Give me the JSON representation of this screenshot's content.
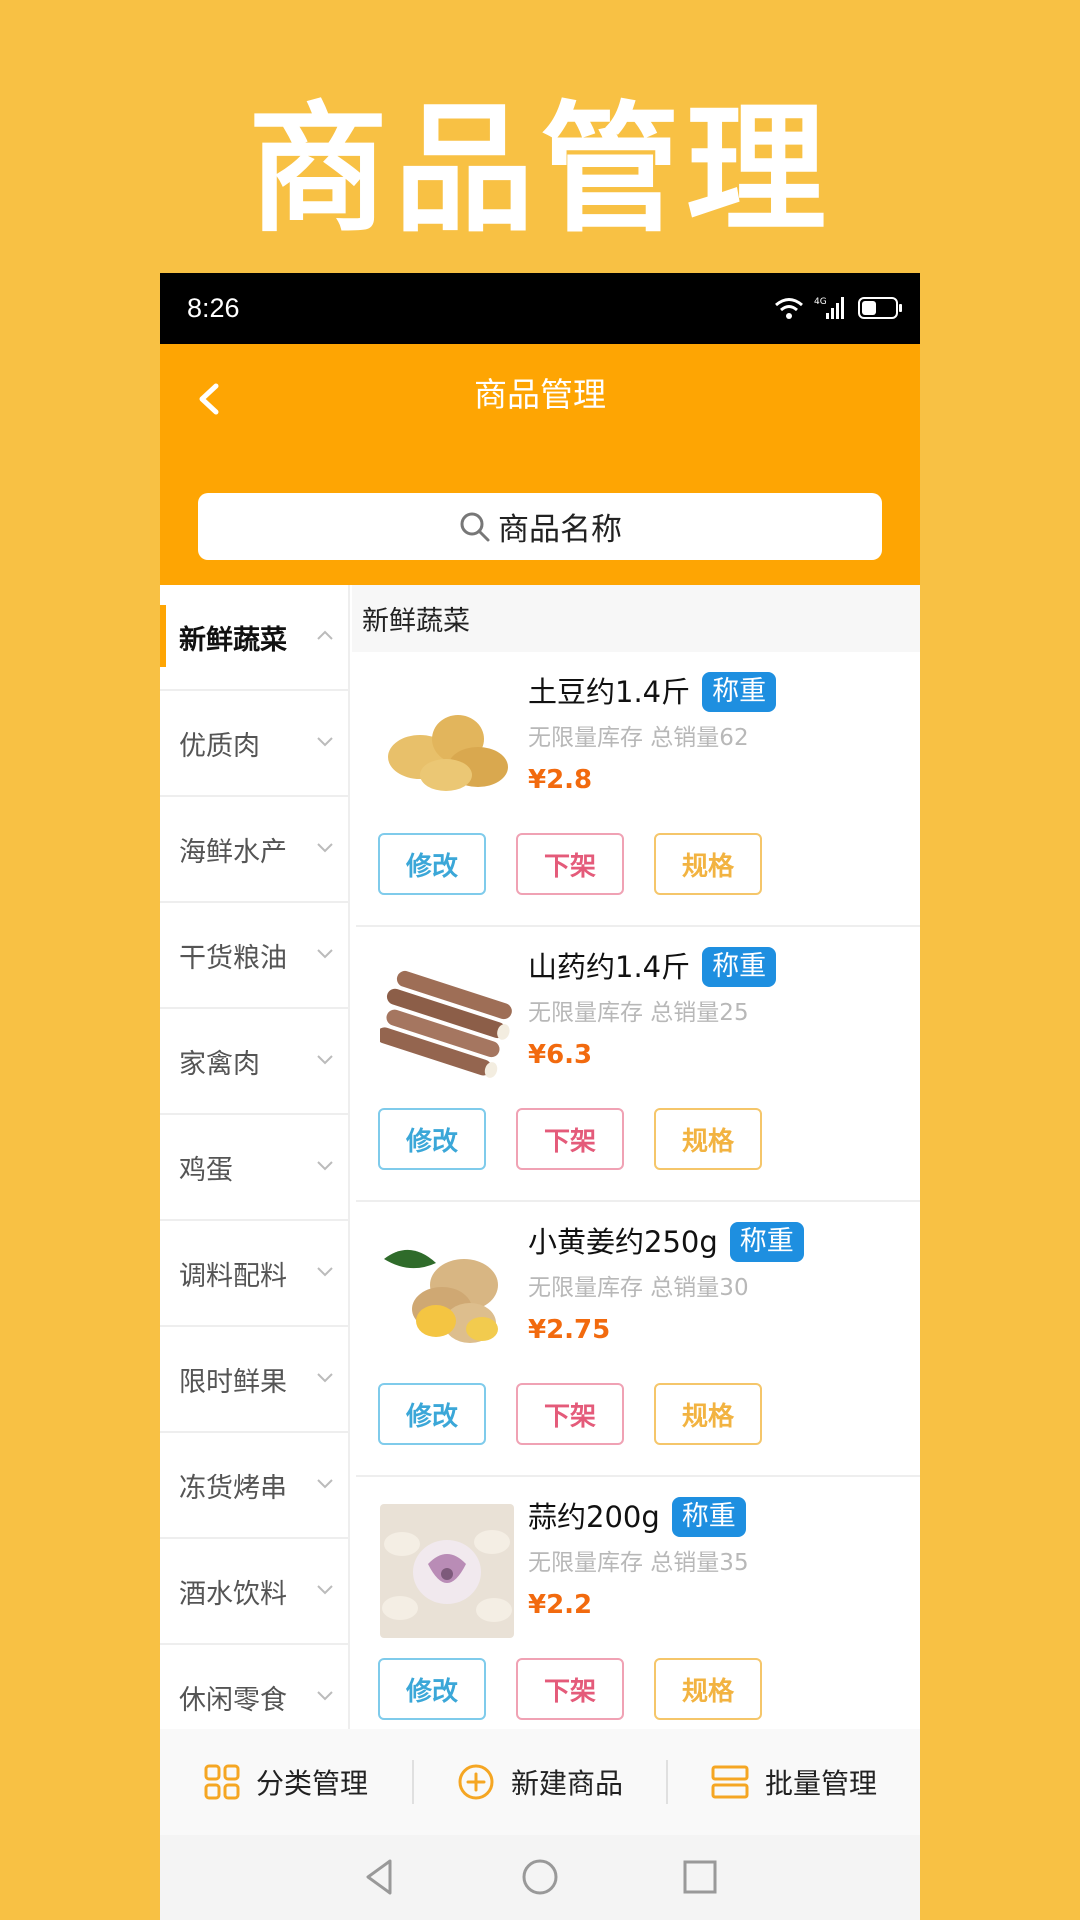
{
  "banner_title": "商品管理",
  "status": {
    "time": "8:26",
    "network": "4G"
  },
  "header": {
    "title": "商品管理"
  },
  "search": {
    "placeholder": "商品名称"
  },
  "categories": [
    {
      "label": "新鲜蔬菜",
      "active": true
    },
    {
      "label": "优质肉"
    },
    {
      "label": "海鲜水产"
    },
    {
      "label": "干货粮油"
    },
    {
      "label": "家禽肉"
    },
    {
      "label": "鸡蛋"
    },
    {
      "label": "调料配料"
    },
    {
      "label": "限时鲜果"
    },
    {
      "label": "冻货烤串"
    },
    {
      "label": "酒水饮料"
    },
    {
      "label": "休闲零食"
    }
  ],
  "section_title": "新鲜蔬菜",
  "products": [
    {
      "name": "土豆约1.4斤",
      "tag": "称重",
      "meta": "无限量库存 总销量62",
      "price": "¥2.8",
      "image": "potato"
    },
    {
      "name": "山药约1.4斤",
      "tag": "称重",
      "meta": "无限量库存 总销量25",
      "price": "¥6.3",
      "image": "yam"
    },
    {
      "name": "小黄姜约250g",
      "tag": "称重",
      "meta": "无限量库存 总销量30",
      "price": "¥2.75",
      "image": "ginger"
    },
    {
      "name": "蒜约200g",
      "tag": "称重",
      "meta": "无限量库存 总销量35",
      "price": "¥2.2",
      "image": "garlic"
    }
  ],
  "product_buttons": {
    "edit": "修改",
    "off_shelf": "下架",
    "spec": "规格"
  },
  "bottom_actions": [
    {
      "label": "分类管理",
      "icon": "grid-icon"
    },
    {
      "label": "新建商品",
      "icon": "plus-circle-icon"
    },
    {
      "label": "批量管理",
      "icon": "list-icon"
    }
  ],
  "colors": {
    "background": "#F8C144",
    "header": "#FEA503",
    "tag": "#1E8FE0",
    "price": "#F26A0E"
  }
}
